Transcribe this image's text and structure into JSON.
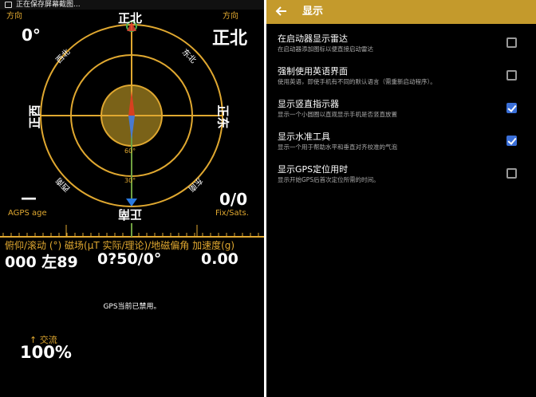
{
  "status_bar": {
    "text": "正在保存屏幕截图..."
  },
  "compass": {
    "heading_label_left": "方向",
    "heading_label_right": "方向",
    "heading_degrees": "0°",
    "heading_direction": "正北",
    "directions": {
      "north": "正北",
      "south": "正南",
      "east": "正东",
      "west": "正西",
      "northeast": "东北",
      "northwest": "西北",
      "southeast": "东南",
      "southwest": "西南"
    },
    "tilt_marks": [
      "60°",
      "30°"
    ],
    "agps_value": "—",
    "agps_label": "AGPS age",
    "fix_value": "0/0",
    "fix_label": "Fix/Sats."
  },
  "readings": {
    "header": "俯仰/滚动 (°) 磁场(μT 实际/理论)/地磁偏角  加速度(g)",
    "pitch_roll": "000 左89",
    "magnetic": "0?50/0°",
    "acceleration": "0.00"
  },
  "gps_status": "GPS当前已禁用。",
  "battery": {
    "label": "↑ 交流",
    "value": "100%"
  },
  "settings_screen": {
    "title": "显示",
    "items": [
      {
        "title": "在启动器显示雷达",
        "subtitle": "在启动器添加图标以便直接启动雷达",
        "checked": false
      },
      {
        "title": "强制使用英语界面",
        "subtitle": "使用英语，即使手机有不同的默认语言（需重新启动程序）。",
        "checked": false
      },
      {
        "title": "显示竖直指示器",
        "subtitle": "显示一个小圆圈以直观显示手机是否竖直放置",
        "checked": true
      },
      {
        "title": "显示水准工具",
        "subtitle": "显示一个用于帮助水平和垂直对齐校准的气泡",
        "checked": true
      },
      {
        "title": "显示GPS定位用时",
        "subtitle": "显示开始GPS后首次定位所需的时间。",
        "checked": false
      }
    ]
  },
  "colors": {
    "accent": "#c49a2c",
    "label": "#e0a830",
    "checkbox": "#3a6fd8"
  }
}
